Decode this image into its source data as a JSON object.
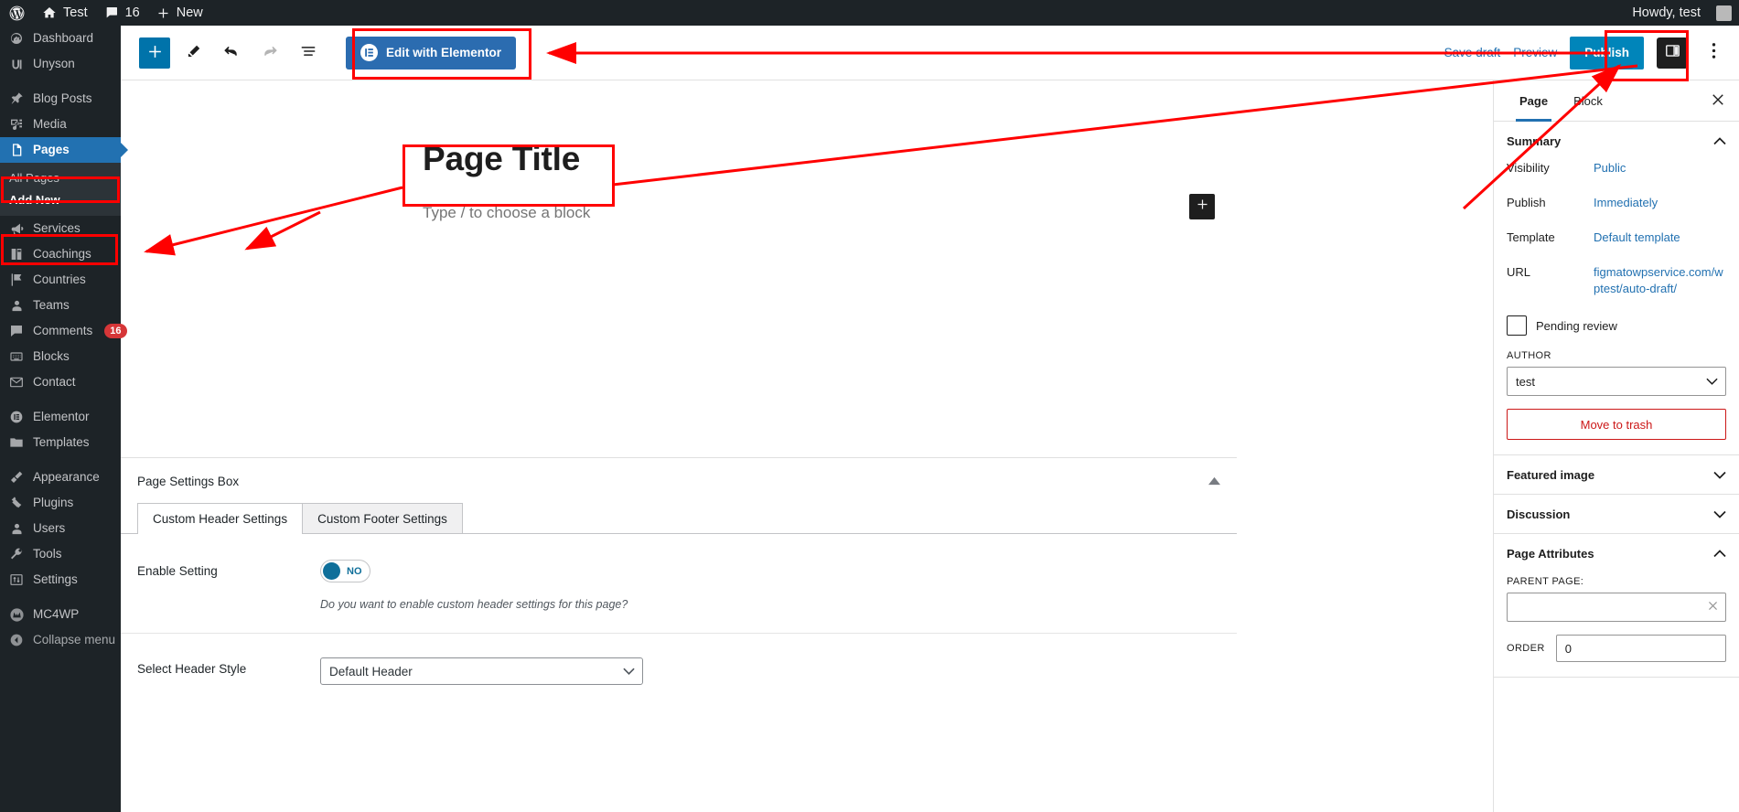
{
  "adminbar": {
    "wp_logo": "wordpress-icon",
    "site_name": "Test",
    "comments_count": "16",
    "new_label": "New",
    "howdy": "Howdy, test"
  },
  "adminmenu": {
    "items": [
      {
        "label": "Dashboard",
        "icon": "dashboard-icon"
      },
      {
        "label": "Unyson",
        "icon": "unyson-icon"
      },
      {
        "label": "Blog Posts",
        "icon": "pin-icon"
      },
      {
        "label": "Media",
        "icon": "media-icon"
      },
      {
        "label": "Pages",
        "icon": "pages-icon",
        "current": true
      },
      {
        "label": "Services",
        "icon": "megaphone-icon"
      },
      {
        "label": "Coachings",
        "icon": "book-icon"
      },
      {
        "label": "Countries",
        "icon": "flag-icon"
      },
      {
        "label": "Teams",
        "icon": "user-icon"
      },
      {
        "label": "Comments",
        "icon": "comment-icon",
        "badge": "16"
      },
      {
        "label": "Blocks",
        "icon": "blocks-icon"
      },
      {
        "label": "Contact",
        "icon": "envelope-icon"
      },
      {
        "label": "Elementor",
        "icon": "elementor-icon"
      },
      {
        "label": "Templates",
        "icon": "folder-icon"
      },
      {
        "label": "Appearance",
        "icon": "brush-icon"
      },
      {
        "label": "Plugins",
        "icon": "plug-icon"
      },
      {
        "label": "Users",
        "icon": "user-icon"
      },
      {
        "label": "Tools",
        "icon": "wrench-icon"
      },
      {
        "label": "Settings",
        "icon": "sliders-icon"
      },
      {
        "label": "MC4WP",
        "icon": "mc4wp-icon"
      },
      {
        "label": "Collapse menu",
        "icon": "collapse-icon"
      }
    ],
    "submenu": [
      {
        "label": "All Pages",
        "current": false
      },
      {
        "label": "Add New",
        "current": true
      }
    ]
  },
  "toolbar": {
    "add_block_title": "Toggle block inserter",
    "tools_title": "Tools",
    "undo_title": "Undo",
    "redo_title": "Redo",
    "list_view_title": "Document Overview",
    "elementor_label": "Edit with Elementor",
    "save_draft_label": "Save draft",
    "preview_label": "Preview",
    "publish_label": "Publish",
    "settings_title": "Settings",
    "options_title": "Options"
  },
  "canvas": {
    "post_title": "Page Title",
    "block_placeholder": "Type / to choose a block",
    "inserter_title": "Add block"
  },
  "metabox": {
    "title": "Page Settings Box",
    "tabs": [
      {
        "label": "Custom Header Settings",
        "active": true
      },
      {
        "label": "Custom Footer Settings",
        "active": false
      }
    ],
    "enable_setting": {
      "label": "Enable Setting",
      "toggle_value": "NO",
      "hint": "Do you want to enable custom header settings for this page?"
    },
    "header_style": {
      "label": "Select Header Style",
      "value": "Default Header"
    }
  },
  "sidebar": {
    "tabs": [
      {
        "label": "Page",
        "active": true
      },
      {
        "label": "Block",
        "active": false
      }
    ],
    "close_title": "Close settings",
    "summary": {
      "title": "Summary",
      "rows": [
        {
          "key": "Visibility",
          "value": "Public"
        },
        {
          "key": "Publish",
          "value": "Immediately"
        },
        {
          "key": "Template",
          "value": "Default template"
        },
        {
          "key": "URL",
          "value": "figmatowpservice.com/wptest/auto-draft/"
        }
      ],
      "pending_review": "Pending review",
      "author_label": "AUTHOR",
      "author_value": "test",
      "trash_label": "Move to trash"
    },
    "featured_image": {
      "title": "Featured image"
    },
    "discussion": {
      "title": "Discussion"
    },
    "page_attributes": {
      "title": "Page Attributes",
      "parent_label": "PARENT PAGE:",
      "parent_value": "",
      "order_label": "ORDER",
      "order_value": "0"
    }
  },
  "annotations": {
    "color": "#ff0000",
    "boxes": [
      {
        "name": "elementor-button-highlight"
      },
      {
        "name": "publish-button-highlight"
      },
      {
        "name": "page-title-highlight"
      },
      {
        "name": "pages-menu-highlight"
      },
      {
        "name": "add-new-menu-highlight"
      }
    ]
  }
}
